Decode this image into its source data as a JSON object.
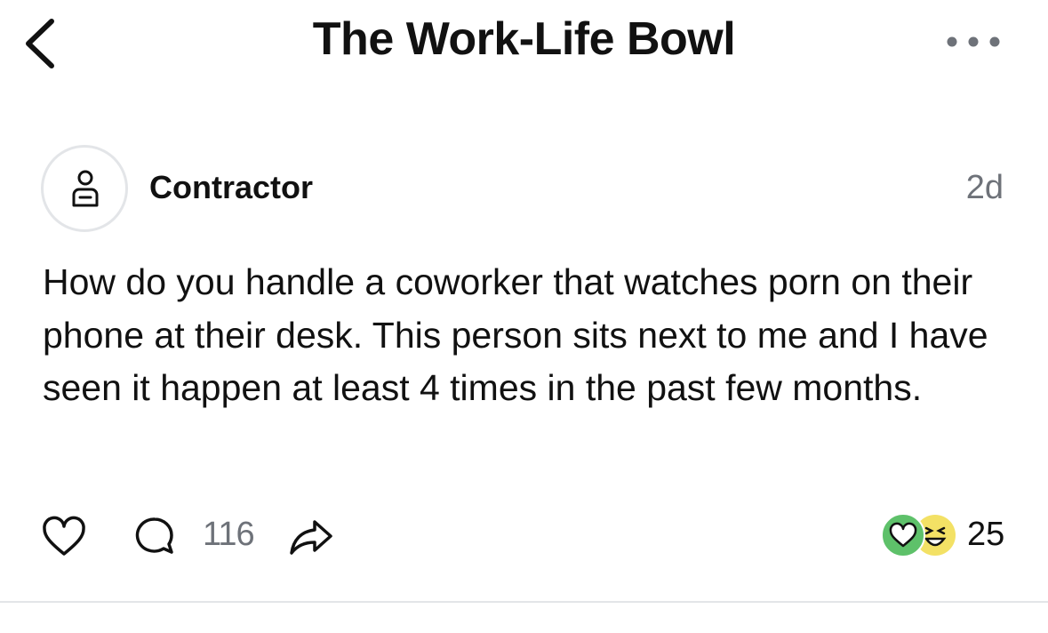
{
  "header": {
    "title": "The Work-Life Bowl",
    "back_icon": "chevron-left-icon",
    "more_icon": "more-horizontal-icon"
  },
  "post": {
    "author": "Contractor",
    "avatar_icon": "anonymous-user-icon",
    "time": "2d",
    "body": "How do you handle a coworker that watches porn on their phone at their desk. This person sits next to me and I have seen it happen at least 4 times in the past few months.",
    "actions": {
      "like_icon": "heart-outline-icon",
      "comment_icon": "comment-bubble-icon",
      "comment_count": "116",
      "share_icon": "share-arrow-icon"
    },
    "reactions": {
      "icons": [
        "heart-reaction-icon",
        "laugh-reaction-icon"
      ],
      "count": "25",
      "colors": {
        "heart": "#5ec16a",
        "laugh": "#f3e165"
      }
    }
  },
  "colors": {
    "text": "#111111",
    "muted": "#6e7279",
    "divider": "#e3e5e8"
  }
}
